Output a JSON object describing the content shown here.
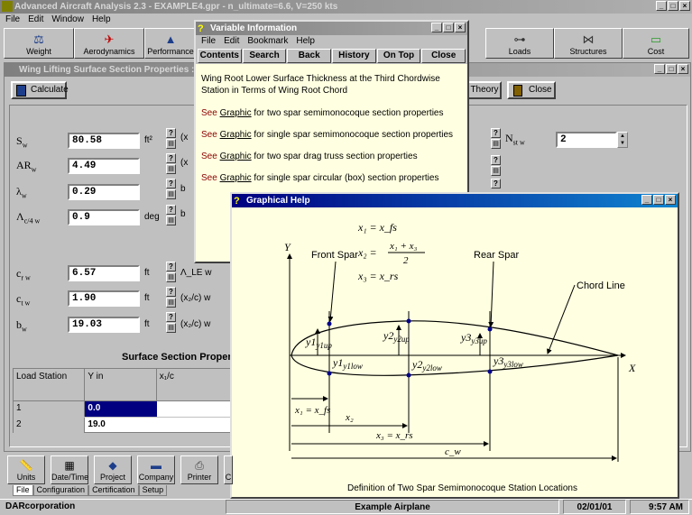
{
  "main": {
    "title": "Advanced Aircraft Analysis 2.3 - EXAMPLE4.gpr - n_ultimate=6.6, V=250 kts",
    "menu": [
      "File",
      "Edit",
      "Window",
      "Help"
    ],
    "toolbar": [
      {
        "label": "Weight",
        "icon": "scale-icon"
      },
      {
        "label": "Aerodynamics",
        "icon": "airplane-icon"
      },
      {
        "label": "Performance",
        "icon": "performance-icon"
      },
      {
        "label": "Loads",
        "icon": "loads-icon"
      },
      {
        "label": "Structures",
        "icon": "truss-icon"
      },
      {
        "label": "Cost",
        "icon": "money-icon"
      }
    ]
  },
  "child": {
    "title": "Wing Lifting Surface Section Properties : n_u",
    "calculate": "Calculate",
    "theory": "Theory",
    "close": "Close",
    "params": [
      {
        "sym": "S",
        "sub": "w",
        "value": "80.58",
        "unit": "ft²"
      },
      {
        "sym": "AR",
        "sub": "w",
        "value": "4.49",
        "unit": ""
      },
      {
        "sym": "λ",
        "sub": "w",
        "value": "0.29",
        "unit": ""
      },
      {
        "sym": "Λ",
        "sub": "c/4 w",
        "value": "0.9",
        "unit": "deg"
      },
      {
        "sym": "c",
        "sub": "r w",
        "value": "6.57",
        "unit": "ft"
      },
      {
        "sym": "c",
        "sub": "t w",
        "value": "1.90",
        "unit": "ft"
      },
      {
        "sym": "b",
        "sub": "w",
        "value": "19.03",
        "unit": "ft"
      }
    ],
    "side_labels": [
      "(x",
      "(x",
      "b",
      "b"
    ],
    "lower_side_labels": [
      "Λ_LE w",
      "(x₂/c) w",
      "(x₂/c) w"
    ],
    "nst": {
      "sym": "N",
      "sub": "st w",
      "value": "2"
    },
    "section_title": "Surface Section Properties",
    "table": {
      "headers": [
        "Load Station",
        "Y  in",
        "x₁/c"
      ],
      "rows": [
        [
          "1",
          "0.0",
          ""
        ],
        [
          "2",
          "19.0",
          ""
        ]
      ]
    }
  },
  "varinfo": {
    "title": "Variable Information",
    "menu": [
      "File",
      "Edit",
      "Bookmark",
      "Help"
    ],
    "buttons": [
      "Contents",
      "Search",
      "Back",
      "History",
      "On Top",
      "Close"
    ],
    "description": "Wing Root Lower Surface Thickness at the Third Chordwise Station in Terms of Wing Root Chord",
    "links": [
      {
        "pre": "See ",
        "link": "Graphic",
        "post": " for two spar semimonocoque section properties"
      },
      {
        "pre": "See ",
        "link": "Graphic",
        "post": " for single spar semimonocoque section properties"
      },
      {
        "pre": "See ",
        "link": "Graphic",
        "post": " for two spar drag truss section properties"
      },
      {
        "pre": "See ",
        "link": "Graphic",
        "post": " for single spar circular (box) section properties"
      }
    ]
  },
  "graph": {
    "title": "Graphical Help",
    "labels": {
      "eq1": "x₁ = x_fs",
      "eq2a": "x₂ =",
      "eq2num": "x₁ + x₃",
      "eq2den": "2",
      "eq3": "x₃ = x_rs",
      "front": "Front Spar",
      "rear": "Rear Spar",
      "chord": "Chord Line",
      "y": "Y",
      "x": "X",
      "y1up": "y1up",
      "y2up": "y2up",
      "y3up": "y3up",
      "y1low": "y1low",
      "y2low": "y2low",
      "y3low": "y3low",
      "dx1": "x₁ = x_fs",
      "dx2": "x₂",
      "dx3": "x₃ = x_rs",
      "cw": "c_w",
      "caption": "Definition of Two Spar Semimonocoque Station Locations"
    }
  },
  "bottom": {
    "buttons": [
      "Units",
      "Date/Time",
      "Project",
      "Company",
      "Printer",
      "C"
    ],
    "tabs": [
      "File",
      "Configuration",
      "Certification",
      "Setup"
    ],
    "status": {
      "company": "DARcorporation",
      "project": "Example Airplane",
      "date": "02/01/01",
      "time": "9:57 AM"
    }
  }
}
